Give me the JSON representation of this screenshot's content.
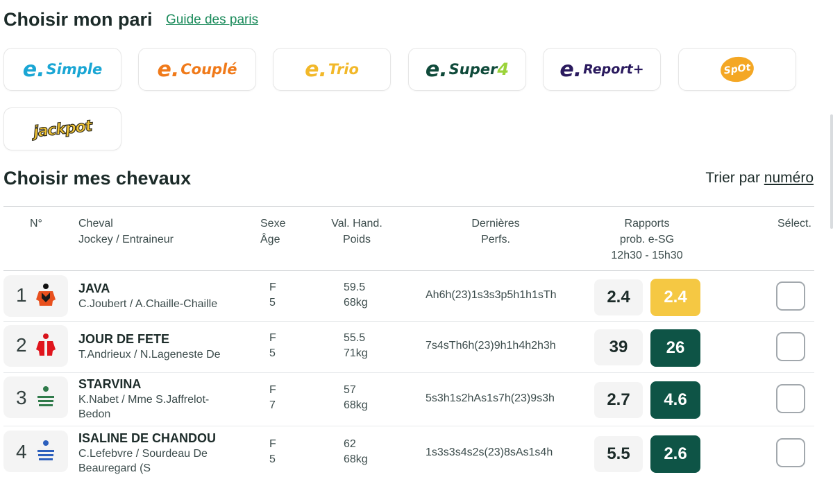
{
  "section1": {
    "title": "Choisir mon pari",
    "guide_link": "Guide des paris"
  },
  "bet_types": [
    {
      "prefix": "e.",
      "name": "Simple",
      "color": "#1aa6d4"
    },
    {
      "prefix": "e.",
      "name": "Couplé",
      "color": "#f07a1a"
    },
    {
      "prefix": "e.",
      "name": "Trio",
      "color": "#f2b829"
    },
    {
      "prefix": "e.",
      "name": "Super",
      "suffix": "4",
      "color": "#0f4a3a",
      "accent": "#9bd33a"
    },
    {
      "prefix": "e.",
      "name": "Report+",
      "color": "#2a1a5e"
    },
    {
      "name": "SpOt",
      "color": "#f4a724"
    },
    {
      "name": "jackpot",
      "color": "#f2c534"
    }
  ],
  "section2": {
    "title": "Choisir mes chevaux",
    "sort_label": "Trier par",
    "sort_value": "numéro"
  },
  "columns": {
    "num": "N°",
    "horse_l1": "Cheval",
    "horse_l2": "Jockey / Entraineur",
    "sex_l1": "Sexe",
    "sex_l2": "Âge",
    "hand_l1": "Val. Hand.",
    "hand_l2": "Poids",
    "perf_l1": "Dernières",
    "perf_l2": "Perfs.",
    "rap_l1": "Rapports",
    "rap_l2": "prob. e-SG",
    "rap_l3": "12h30 - 15h30",
    "select": "Sélect."
  },
  "horses": [
    {
      "num": "1",
      "name": "JAVA",
      "jockey": "C.Joubert / A.Chaille-Chaille",
      "sex": "F",
      "age": "5",
      "handicap": "59.5",
      "weight": "68kg",
      "perfs": "Ah6h(23)1s3s3p5h1h1sTh",
      "odds_1230": "2.4",
      "odds_1530": "2.4",
      "odds_color": "#f5c843"
    },
    {
      "num": "2",
      "name": "JOUR DE FETE",
      "jockey": "T.Andrieux / N.Lageneste De",
      "sex": "F",
      "age": "5",
      "handicap": "55.5",
      "weight": "71kg",
      "perfs": "7s4sTh6h(23)9h1h4h2h3h",
      "odds_1230": "39",
      "odds_1530": "26",
      "odds_color": "#0e5446"
    },
    {
      "num": "3",
      "name": "STARVINA",
      "jockey": "K.Nabet / Mme S.Jaffrelot-Bedon",
      "sex": "F",
      "age": "7",
      "handicap": "57",
      "weight": "68kg",
      "perfs": "5s3h1s2hAs1s7h(23)9s3h",
      "odds_1230": "2.7",
      "odds_1530": "4.6",
      "odds_color": "#0e5446"
    },
    {
      "num": "4",
      "name": "ISALINE DE CHANDOU",
      "jockey": "C.Lefebvre / Sourdeau De Beauregard (S",
      "sex": "F",
      "age": "5",
      "handicap": "62",
      "weight": "68kg",
      "perfs": "1s3s3s4s2s(23)8sAs1s4h",
      "odds_1230": "5.5",
      "odds_1530": "2.6",
      "odds_color": "#0e5446"
    }
  ]
}
